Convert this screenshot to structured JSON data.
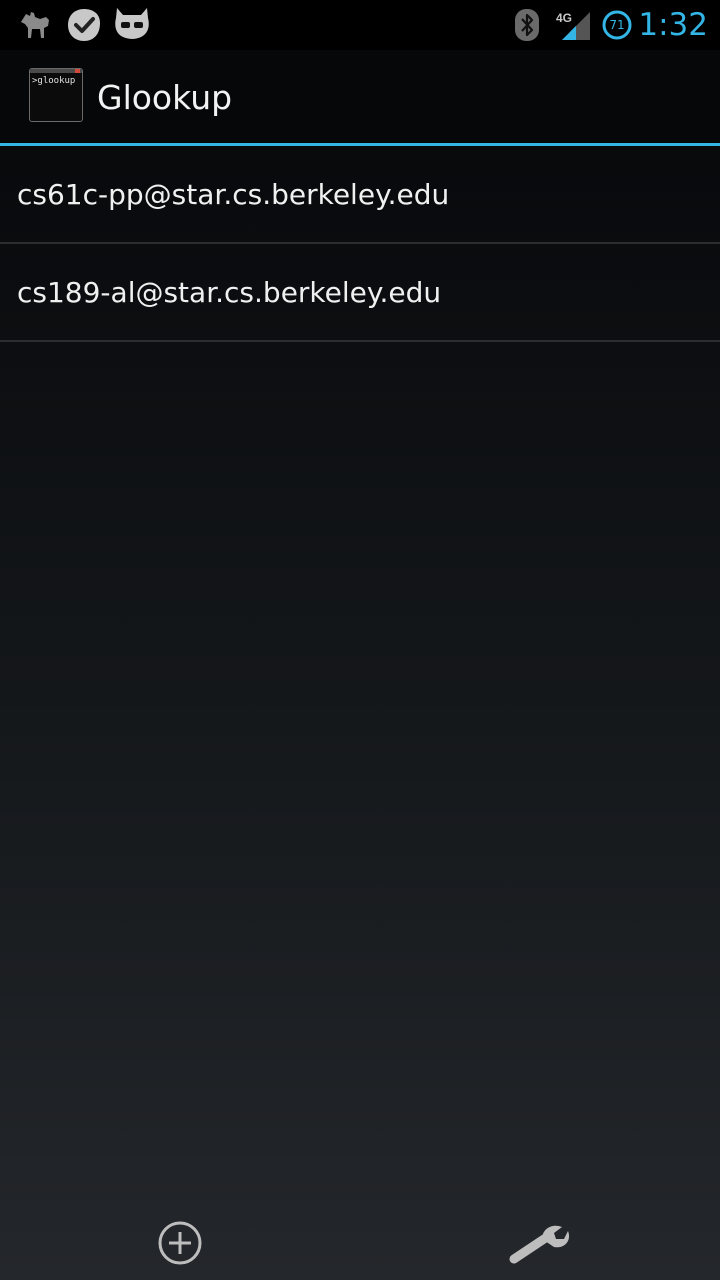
{
  "status_bar": {
    "time": "1:32",
    "battery_level": "71",
    "network_type": "4G",
    "notification_icons": [
      "camel-icon",
      "check-badge-icon",
      "cyanogen-mascot-icon"
    ],
    "system_icons": [
      "bluetooth-icon",
      "signal-icon",
      "battery-icon"
    ],
    "accent_color": "#33b5e5"
  },
  "action_bar": {
    "app_icon_text": ">glookup",
    "title": "Glookup",
    "divider_color": "#33b5e5"
  },
  "accounts": [
    {
      "label": "cs61c-pp@star.cs.berkeley.edu"
    },
    {
      "label": "cs189-al@star.cs.berkeley.edu"
    }
  ],
  "bottom_actions": [
    {
      "icon": "add-circle-icon"
    },
    {
      "icon": "wrench-icon"
    }
  ]
}
